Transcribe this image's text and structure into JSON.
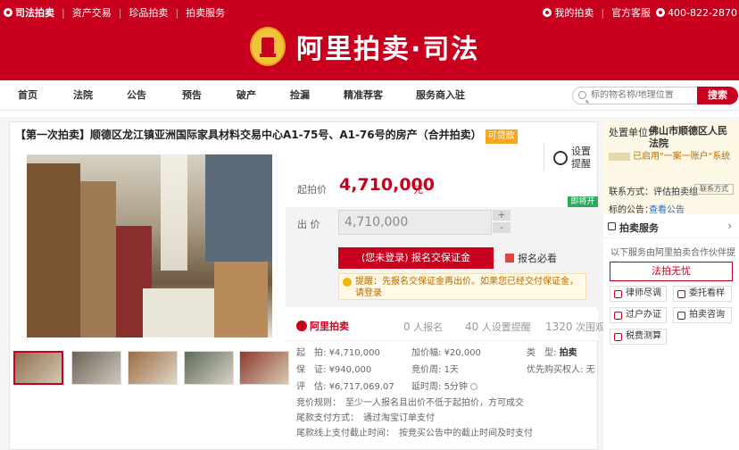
{
  "topbar": {
    "brand": "司法拍卖",
    "links": [
      "资产交易",
      "珍品拍卖",
      "拍卖服务"
    ],
    "my_auction": "我的拍卖",
    "service": "官方客服",
    "phone": "400-822-2870"
  },
  "banner": {
    "logo_text": "阿里拍卖·司法"
  },
  "nav": {
    "items": [
      "首页",
      "法院",
      "公告",
      "预告",
      "破产",
      "捡漏",
      "精准荐客",
      "服务商入驻"
    ],
    "search_placeholder": "标的物名称/地理位置",
    "search_button": "搜索"
  },
  "lot": {
    "title": "【第一次拍卖】顺德区龙江镇亚洲国际家具材料交易中心A1-75号、A1-76号的房产（合并拍卖）",
    "loan_tag": "可贷款",
    "remind": "设置提醒",
    "start_label": "起拍价",
    "start_price": "4,710,000",
    "unit": "元",
    "status": "即将开始",
    "offer_label": "出 价",
    "offer_value": "4,710,000",
    "plus": "+",
    "minus": "-",
    "signup_button": "(您未登录) 报名交保证金",
    "must_read": "报名必看",
    "tip": "提醒：先报名交保证金再出价。如果您已经交付保证金，请登录"
  },
  "stats": {
    "logo": "阿里拍卖",
    "signup_count": "0",
    "signup_label": "人报名",
    "reminder_count": "40",
    "reminder_label": "人设置提醒",
    "view_count": "1320",
    "view_label": "次围观"
  },
  "info": {
    "start": {
      "label": "起　拍",
      "value": "¥4,710,000"
    },
    "increment": {
      "label": "加价幅",
      "value": "¥20,000"
    },
    "type": {
      "label": "类　型",
      "value": "拍卖"
    },
    "deposit": {
      "label": "保　证",
      "value": "¥940,000"
    },
    "cycle": {
      "label": "竞价周",
      "value": "1天"
    },
    "priority": {
      "label": "优先购买权人",
      "value": "无"
    },
    "appraisal": {
      "label": "评　估",
      "value": "¥6,717,069.07"
    },
    "delay": {
      "label": "延时周",
      "value": "5分钟"
    },
    "rule": "竞价规则：　至少一人报名且出价不低于起拍价，方可成交",
    "payment": "尾款支付方式：　通过淘宝订单支付",
    "deadline": "尾款线上支付截止时间：　按竞买公告中的截止时间及时支付"
  },
  "right": {
    "org_label": "处置单位:",
    "org_name": "佛山市顺德区人民法院",
    "safe_label": "已启用\"一案一账户\"系统",
    "contact_label": "联系方式：",
    "contact_value": "评估拍卖组",
    "contact_tag": "联系方式",
    "notice_label": "标的公告：",
    "notice_link": "查看公告",
    "service_title": "拍卖服务",
    "service_desc": "以下服务由阿里拍卖合作伙伴提供",
    "service_button": "法拍无忧",
    "services": [
      "律师尽调",
      "委托看样",
      "过户办证",
      "拍卖咨询",
      "税费测算"
    ]
  },
  "colors": {
    "brand": "#c8001e",
    "status_green": "#2eaa5c"
  }
}
